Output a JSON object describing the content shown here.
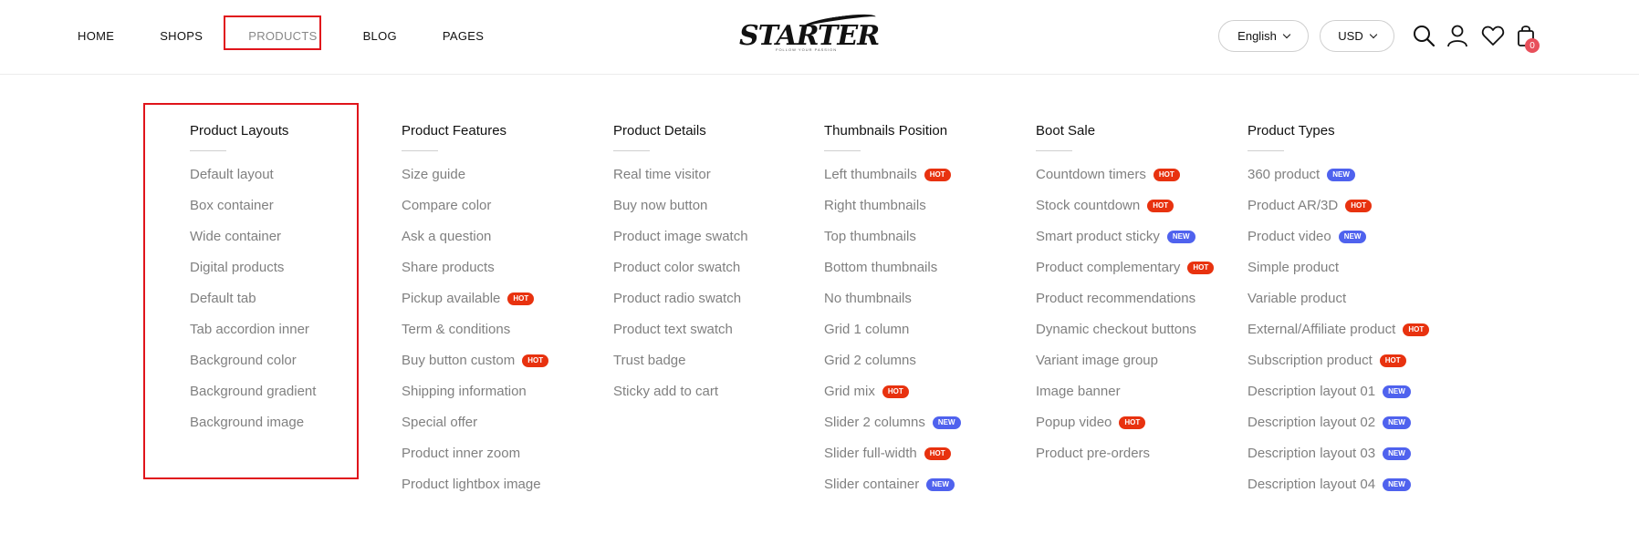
{
  "nav": {
    "items": [
      "HOME",
      "SHOPS",
      "PRODUCTS",
      "BLOG",
      "PAGES"
    ],
    "active": "PRODUCTS"
  },
  "logo": {
    "text": "STARTER",
    "tagline": "FOLLOW YOUR PASSION"
  },
  "language": {
    "selected": "English"
  },
  "currency": {
    "selected": "USD"
  },
  "cart": {
    "count": "0"
  },
  "icons": [
    "search-icon",
    "user-icon",
    "heart-icon",
    "cart-icon",
    "chevron-down-icon"
  ],
  "colors": {
    "hot": "#e8320f",
    "new": "#4f62ee",
    "highlight": "#e0141b",
    "cart_badge": "#e8505b"
  },
  "mega_menu": {
    "columns": [
      {
        "title": "Product Layouts",
        "items": [
          {
            "label": "Default layout",
            "badge": ""
          },
          {
            "label": "Box container",
            "badge": ""
          },
          {
            "label": "Wide container",
            "badge": ""
          },
          {
            "label": "Digital products",
            "badge": ""
          },
          {
            "label": "Default tab",
            "badge": ""
          },
          {
            "label": "Tab accordion inner",
            "badge": ""
          },
          {
            "label": "Background color",
            "badge": ""
          },
          {
            "label": "Background gradient",
            "badge": ""
          },
          {
            "label": "Background image",
            "badge": ""
          }
        ]
      },
      {
        "title": "Product Features",
        "items": [
          {
            "label": "Size guide",
            "badge": ""
          },
          {
            "label": "Compare color",
            "badge": ""
          },
          {
            "label": "Ask a question",
            "badge": ""
          },
          {
            "label": "Share products",
            "badge": ""
          },
          {
            "label": "Pickup available",
            "badge": "HOT"
          },
          {
            "label": "Term & conditions",
            "badge": ""
          },
          {
            "label": "Buy button custom",
            "badge": "HOT"
          },
          {
            "label": "Shipping information",
            "badge": ""
          },
          {
            "label": "Special offer",
            "badge": ""
          },
          {
            "label": "Product inner zoom",
            "badge": ""
          },
          {
            "label": "Product lightbox image",
            "badge": ""
          }
        ]
      },
      {
        "title": "Product Details",
        "items": [
          {
            "label": "Real time visitor",
            "badge": ""
          },
          {
            "label": "Buy now button",
            "badge": ""
          },
          {
            "label": "Product image swatch",
            "badge": ""
          },
          {
            "label": "Product color swatch",
            "badge": ""
          },
          {
            "label": "Product radio swatch",
            "badge": ""
          },
          {
            "label": "Product text swatch",
            "badge": ""
          },
          {
            "label": "Trust badge",
            "badge": ""
          },
          {
            "label": "Sticky add to cart",
            "badge": ""
          }
        ]
      },
      {
        "title": "Thumbnails Position",
        "items": [
          {
            "label": "Left thumbnails",
            "badge": "HOT"
          },
          {
            "label": "Right thumbnails",
            "badge": ""
          },
          {
            "label": "Top thumbnails",
            "badge": ""
          },
          {
            "label": "Bottom thumbnails",
            "badge": ""
          },
          {
            "label": "No thumbnails",
            "badge": ""
          },
          {
            "label": "Grid 1 column",
            "badge": ""
          },
          {
            "label": "Grid 2 columns",
            "badge": ""
          },
          {
            "label": "Grid mix",
            "badge": "HOT"
          },
          {
            "label": "Slider 2 columns",
            "badge": "NEW"
          },
          {
            "label": "Slider full-width",
            "badge": "HOT"
          },
          {
            "label": "Slider container",
            "badge": "NEW"
          }
        ]
      },
      {
        "title": "Boot Sale",
        "items": [
          {
            "label": "Countdown timers",
            "badge": "HOT"
          },
          {
            "label": "Stock countdown",
            "badge": "HOT"
          },
          {
            "label": "Smart product sticky",
            "badge": "NEW"
          },
          {
            "label": "Product complementary",
            "badge": "HOT"
          },
          {
            "label": "Product recommendations",
            "badge": ""
          },
          {
            "label": "Dynamic checkout buttons",
            "badge": ""
          },
          {
            "label": "Variant image group",
            "badge": ""
          },
          {
            "label": "Image banner",
            "badge": ""
          },
          {
            "label": "Popup video",
            "badge": "HOT"
          },
          {
            "label": "Product pre-orders",
            "badge": ""
          }
        ]
      },
      {
        "title": "Product Types",
        "items": [
          {
            "label": "360 product",
            "badge": "NEW"
          },
          {
            "label": "Product AR/3D",
            "badge": "HOT"
          },
          {
            "label": "Product video",
            "badge": "NEW"
          },
          {
            "label": "Simple product",
            "badge": ""
          },
          {
            "label": "Variable product",
            "badge": ""
          },
          {
            "label": "External/Affiliate product",
            "badge": "HOT"
          },
          {
            "label": "Subscription product",
            "badge": "HOT"
          },
          {
            "label": "Description layout 01",
            "badge": "NEW"
          },
          {
            "label": "Description layout 02",
            "badge": "NEW"
          },
          {
            "label": "Description layout 03",
            "badge": "NEW"
          },
          {
            "label": "Description layout 04",
            "badge": "NEW"
          }
        ]
      }
    ]
  }
}
